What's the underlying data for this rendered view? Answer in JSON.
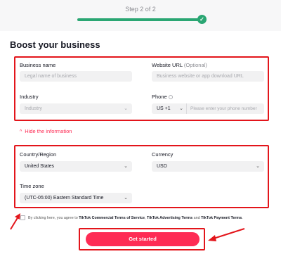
{
  "header": {
    "step_label": "Step 2 of 2",
    "progress_fraction": 1.0,
    "step_complete": "✓"
  },
  "page_title": "Boost your business",
  "business": {
    "name_label": "Business name",
    "name_placeholder": "Legal name of business",
    "website_label": "Website URL",
    "website_optional": "(Optional)",
    "website_placeholder": "Business website or app download URL",
    "industry_label": "Industry",
    "industry_placeholder": "Industry",
    "phone_label": "Phone",
    "phone_code": "US +1",
    "phone_placeholder": "Please enter your phone number"
  },
  "hide_info": {
    "caret": "^",
    "label": "Hide the information"
  },
  "region": {
    "country_label": "Country/Region",
    "country_value": "United States",
    "currency_label": "Currency",
    "currency_value": "USD",
    "timezone_label": "Time zone",
    "timezone_value": "(UTC-05:00) Eastern Standard Time"
  },
  "consent": {
    "prefix": "By clicking here, you agree to ",
    "link1": "TikTok Commercial Terms of Service",
    "sep1": ", ",
    "link2": "TikTok Advertising Terms",
    "sep2": " and ",
    "link3": "TikTok Payment Terms",
    "suffix": "."
  },
  "cta_label": "Get started",
  "colors": {
    "accent": "#fe2c55",
    "annotation_red": "#e3151b",
    "success": "#2aa673"
  }
}
